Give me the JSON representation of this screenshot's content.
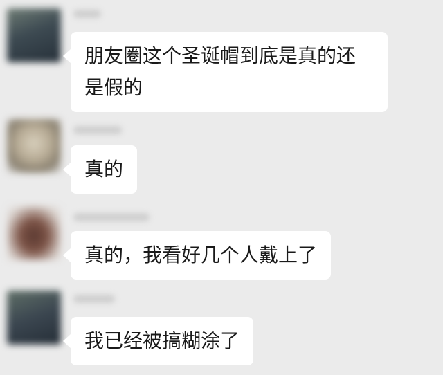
{
  "messages": [
    {
      "text": "朋友圈这个圣诞帽到底是真的还是假的"
    },
    {
      "text": "真的"
    },
    {
      "text": "真的，我看好几个人戴上了"
    },
    {
      "text": "我已经被搞糊涂了"
    }
  ]
}
